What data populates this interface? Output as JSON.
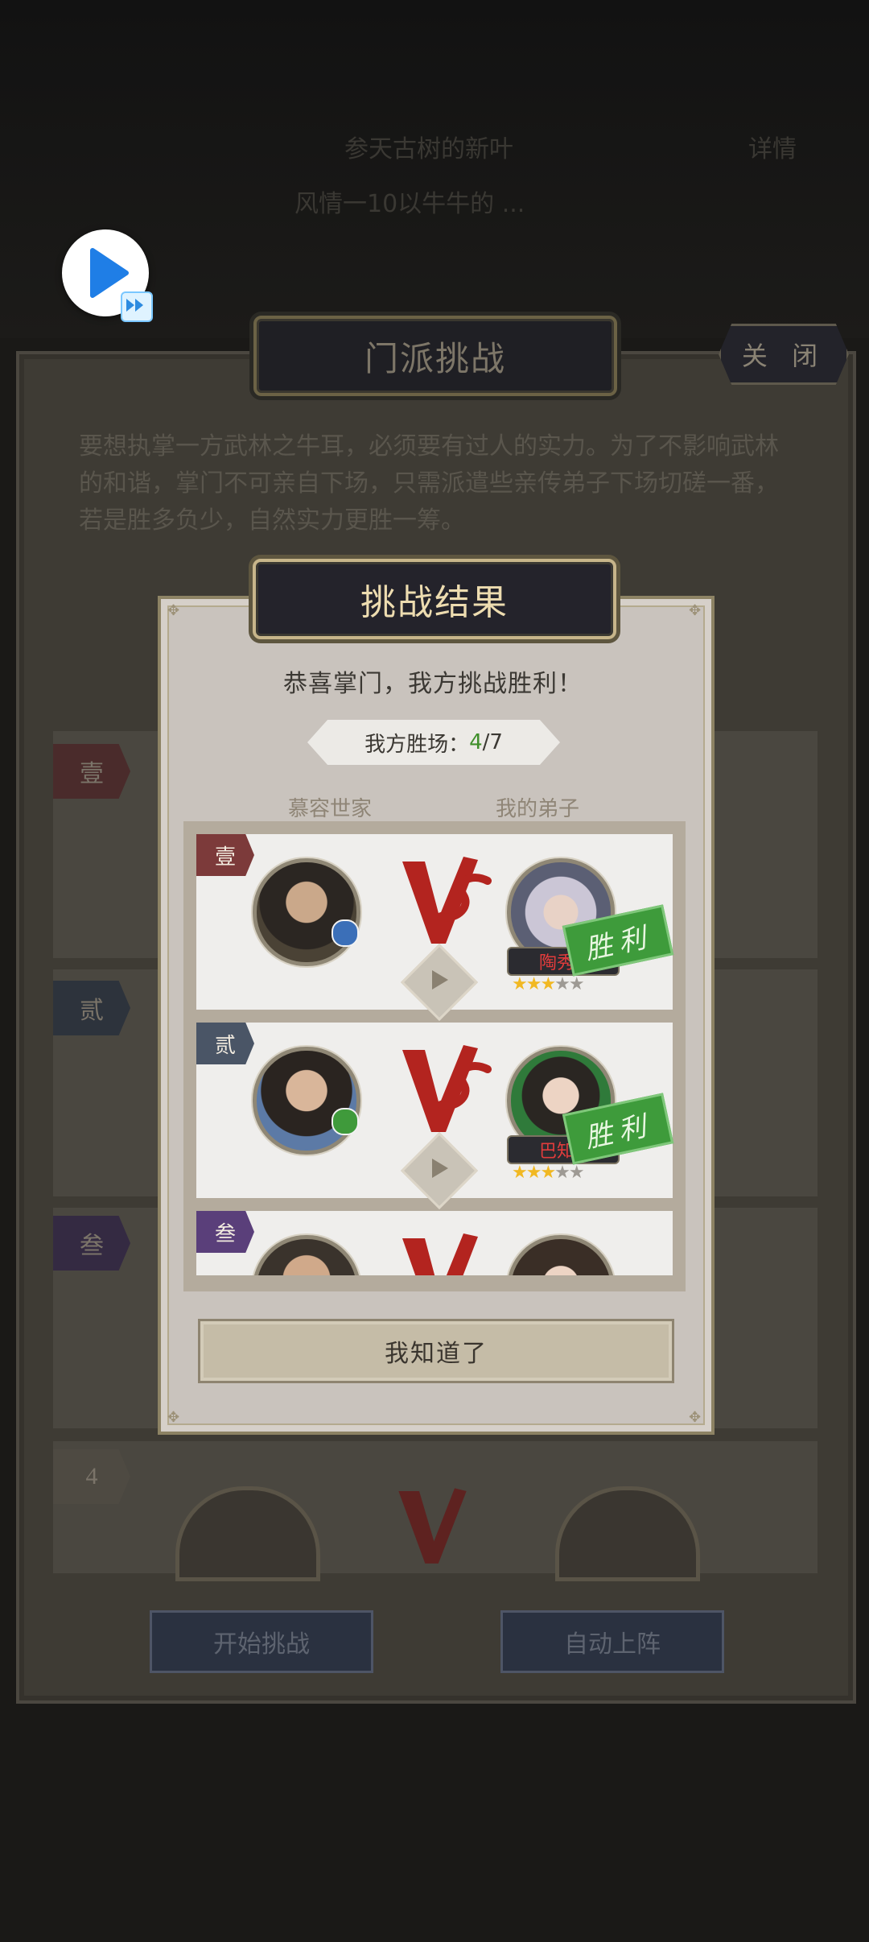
{
  "background_header": {
    "line1": "参天古树的新叶",
    "line2": "详情",
    "line3": "风情一10以牛牛的 ..."
  },
  "main_panel": {
    "title": "门派挑战",
    "close_label": "关 闭",
    "intro": "要想执掌一方武林之牛耳，必须要有过人的实力。为了不影响武林的和谐，掌门不可亲自下场，只需派遣些亲传弟子下场切磋一番，若是胜多负少，自然实力更胜一筹。",
    "row_tags": [
      "壹",
      "贰",
      "叁",
      "4"
    ],
    "start_button": "开始挑战",
    "auto_button": "自动上阵"
  },
  "dialog": {
    "title": "挑战结果",
    "message": "恭喜掌门，我方挑战胜利！",
    "wins_label": "我方胜场：",
    "wins_value": "4",
    "wins_total": "/7",
    "left_team": "慕容世家",
    "right_team": "我的弟子",
    "matches": [
      {
        "tag": "壹",
        "player_name": "陶秀",
        "stars": 3,
        "max_stars": 5,
        "result": "胜利",
        "tag_color": "#7c3a3a"
      },
      {
        "tag": "贰",
        "player_name": "巴知",
        "stars": 3,
        "max_stars": 5,
        "result": "胜利",
        "tag_color": "#4a5566"
      },
      {
        "tag": "叁",
        "tag_color": "#5a3f7a"
      }
    ],
    "confirm_button": "我知道了"
  },
  "colors": {
    "win_green": "#3e9b3b",
    "accent_gold": "#c7b58a",
    "vs_red": "#b3241f"
  }
}
